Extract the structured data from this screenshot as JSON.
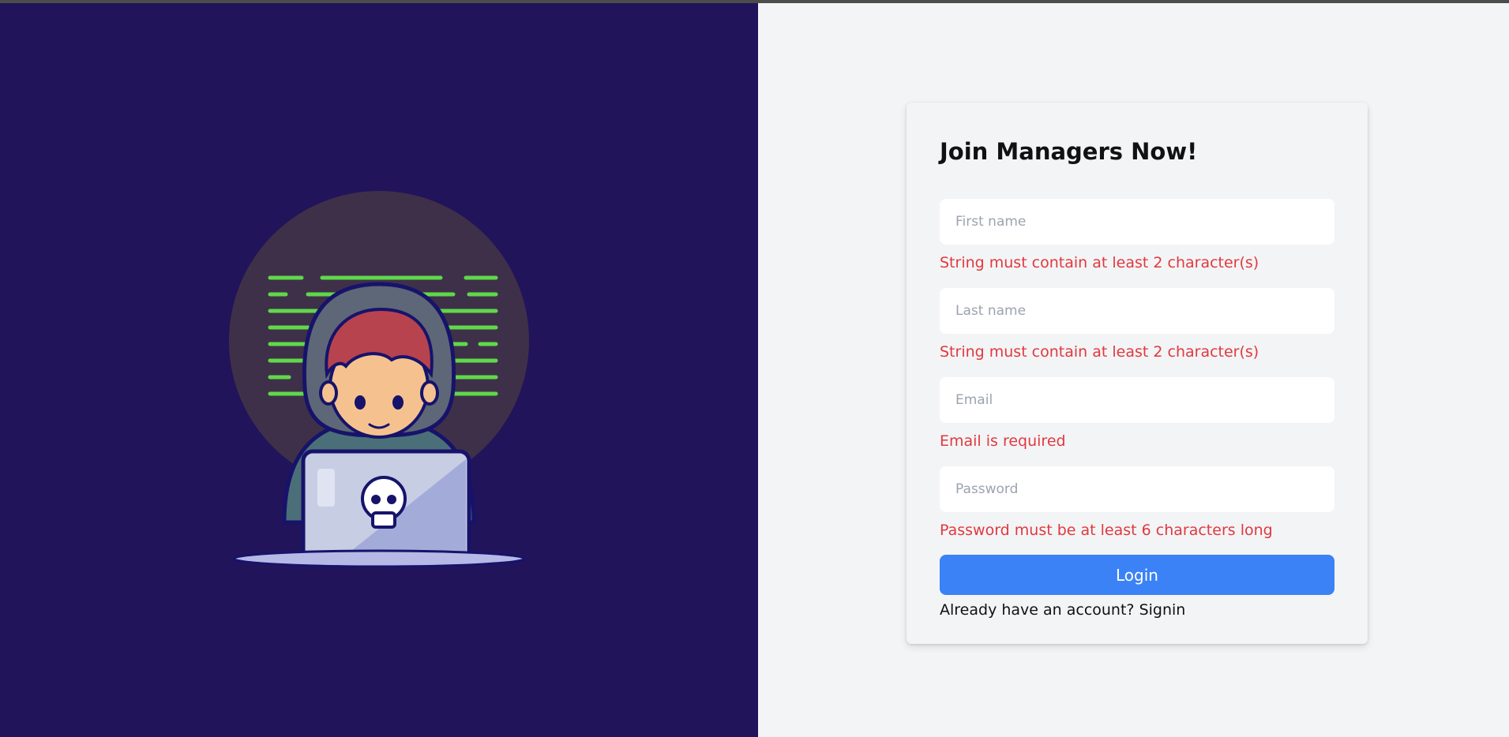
{
  "colors": {
    "left_bg": "#21145a",
    "right_bg": "#f3f4f6",
    "error": "#e0393e",
    "primary": "#3b82f6",
    "code_lines": "#5fd84a"
  },
  "illustration": {
    "icon": "hacker-with-laptop-illustration"
  },
  "form": {
    "title": "Join Managers Now!",
    "first_name": {
      "placeholder": "First name",
      "value": "",
      "error": "String must contain at least 2 character(s)"
    },
    "last_name": {
      "placeholder": "Last name",
      "value": "",
      "error": "String must contain at least 2 character(s)"
    },
    "email": {
      "placeholder": "Email",
      "value": "",
      "error": "Email is required"
    },
    "password": {
      "placeholder": "Password",
      "value": "",
      "error": "Password must be at least 6 characters long"
    },
    "submit_label": "Login",
    "signin_prompt": "Already have an account?",
    "signin_link": "Signin"
  }
}
